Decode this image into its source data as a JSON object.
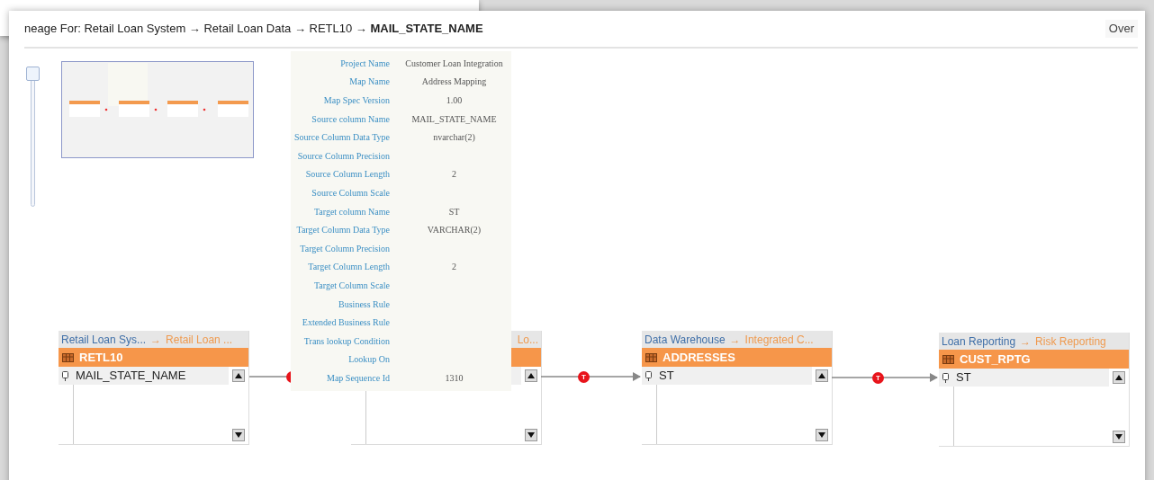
{
  "breadcrumb": {
    "text": "neage For: Retail Loan System → Retail Loan Data → RETL10 → **MAIL_STATE_NAME**"
  },
  "overview_tab": {
    "label": "Over"
  },
  "zoom_slider": {
    "level": 1
  },
  "tooltip": {
    "rows": [
      {
        "label": "Project Name",
        "value": "Customer Loan Integration"
      },
      {
        "label": "Map Name",
        "value": "Address Mapping"
      },
      {
        "label": "Map Spec Version",
        "value": "1.00"
      },
      {
        "label": "Source column Name",
        "value": "MAIL_STATE_NAME"
      },
      {
        "label": "Source Column Data Type",
        "value": "nvarchar(2)"
      },
      {
        "label": "Source Column Precision"
      },
      {
        "label": "Source Column Length",
        "value": "2"
      },
      {
        "label": "Source Column Scale"
      },
      {
        "label": "Target column Name",
        "value": "ST"
      },
      {
        "label": "Target Column Data Type",
        "value": "VARCHAR(2)"
      },
      {
        "label": "Target Column Precision"
      },
      {
        "label": "Target Column Length",
        "value": "2"
      },
      {
        "label": "Target Column Scale"
      },
      {
        "label": "Business Rule"
      },
      {
        "label": "Extended Business Rule"
      },
      {
        "label": "Trans lookup Condition"
      },
      {
        "label": "Lookup On"
      },
      {
        "label": "Map Sequence Id",
        "value": "1310"
      }
    ]
  },
  "nodes": [
    {
      "system": "Retail Loan Sys...",
      "separator": "→",
      "dataset": "Retail Loan ...",
      "table": "RETL10",
      "column": "MAIL_STATE_NAME"
    },
    {
      "dataset": "Lo..."
    },
    {
      "system": "Data Warehouse",
      "separator": "→",
      "dataset": "Integrated C...",
      "table": "ADDRESSES",
      "column": "ST"
    },
    {
      "system": "Loan Reporting",
      "separator": "→",
      "dataset": "Risk Reporting",
      "table": "CUST_RPTG",
      "column": "ST"
    }
  ],
  "connectors": [
    {
      "kind": "covered"
    },
    {
      "kind": "labeled",
      "label": "T"
    },
    {
      "kind": "labeled",
      "label": "T"
    }
  ]
}
